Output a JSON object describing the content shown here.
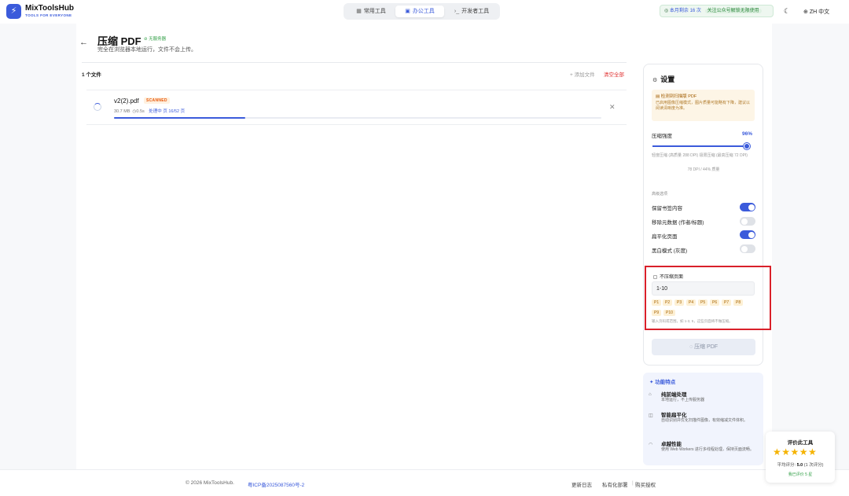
{
  "app": {
    "name": "MixToolsHub",
    "tagline": "TOOLS FOR EVERYONE",
    "logo_icon": "bolt"
  },
  "nav": {
    "tabs": [
      {
        "label": "常用工具",
        "icon": "grid-icon",
        "active": false
      },
      {
        "label": "办公工具",
        "icon": "briefcase-icon",
        "active": true
      },
      {
        "label": "开发者工具",
        "icon": "terminal-icon",
        "active": false
      }
    ]
  },
  "header_right": {
    "usage_text": "本月剩余 16 次",
    "follow_text": "关注公众号解锁无限使用",
    "theme_icon": "moon-icon",
    "language": "ZH 中文"
  },
  "page": {
    "title": "压缩 PDF",
    "badge": "无服务器",
    "subtitle": "完全在浏览器本地运行，文件不会上传。"
  },
  "files": {
    "count_label": "1 个文件",
    "add_label": "+ 添加文件",
    "clear_label": "清空全部",
    "items": [
      {
        "name": "v2(2).pdf",
        "tag": "SCANNED",
        "size": "30.7 MB",
        "time": "0.5s",
        "status": "处理中 页 16/52 页",
        "progress": 0.27
      }
    ]
  },
  "settings": {
    "title": "设置",
    "notice_title": "检测到扫描版 PDF",
    "notice_body": "已启用图像压缩模式，图片质量可能略有下降，建议以阅读清晰度为准。",
    "strength_label": "压缩强度",
    "strength_value": "96%",
    "strength": 0.96,
    "slider_hint": "轻度压缩 (高质量 288 DPI)    极限压缩 (最高压缩 72 DPI)",
    "dpi_text": "78 DPI / 44% 质量",
    "advanced_label": "高级选项",
    "options": [
      {
        "label": "保留书签内容",
        "on": true
      },
      {
        "label": "移除元数据 (作者/标题)",
        "on": false
      },
      {
        "label": "扁平化页面",
        "on": true
      },
      {
        "label": "黑白模式 (灰度)",
        "on": false
      }
    ],
    "no_compress": {
      "label": "不压缩页面",
      "value": "1-10",
      "chips": [
        "P1",
        "P2",
        "P3",
        "P4",
        "P5",
        "P6",
        "P7",
        "P8",
        "P9",
        "P10"
      ],
      "hint": "输入页码或范围，如 1-3, 5，这些页面将不做压缩。"
    },
    "compress_button": "压缩 PDF"
  },
  "features": {
    "title": "功能特点",
    "items": [
      {
        "head": "纯前端处理",
        "desc": "本地运行，不上传服务器",
        "icon": "shield-icon"
      },
      {
        "head": "智能扁平化",
        "desc": "自动识别并优化扫描件图像，有效缩减文件体积。",
        "icon": "layers-icon"
      },
      {
        "head": "卓越性能",
        "desc": "使用 Web Workers 进行多线程处理，保持页面流畅。",
        "icon": "gauge-icon"
      }
    ]
  },
  "rating": {
    "title": "评价此工具",
    "stars": "★★★★★",
    "avg_prefix": "平均评分: ",
    "avg_value": "5.0",
    "avg_suffix": " (1 次评分)",
    "link": "我已评价 5 星"
  },
  "footer": {
    "copyright": "© 2026 MixToolsHub.",
    "icp": "粤ICP备2025087560号-2",
    "links": [
      "更新日志",
      "私有化部署",
      "购买授权"
    ]
  }
}
